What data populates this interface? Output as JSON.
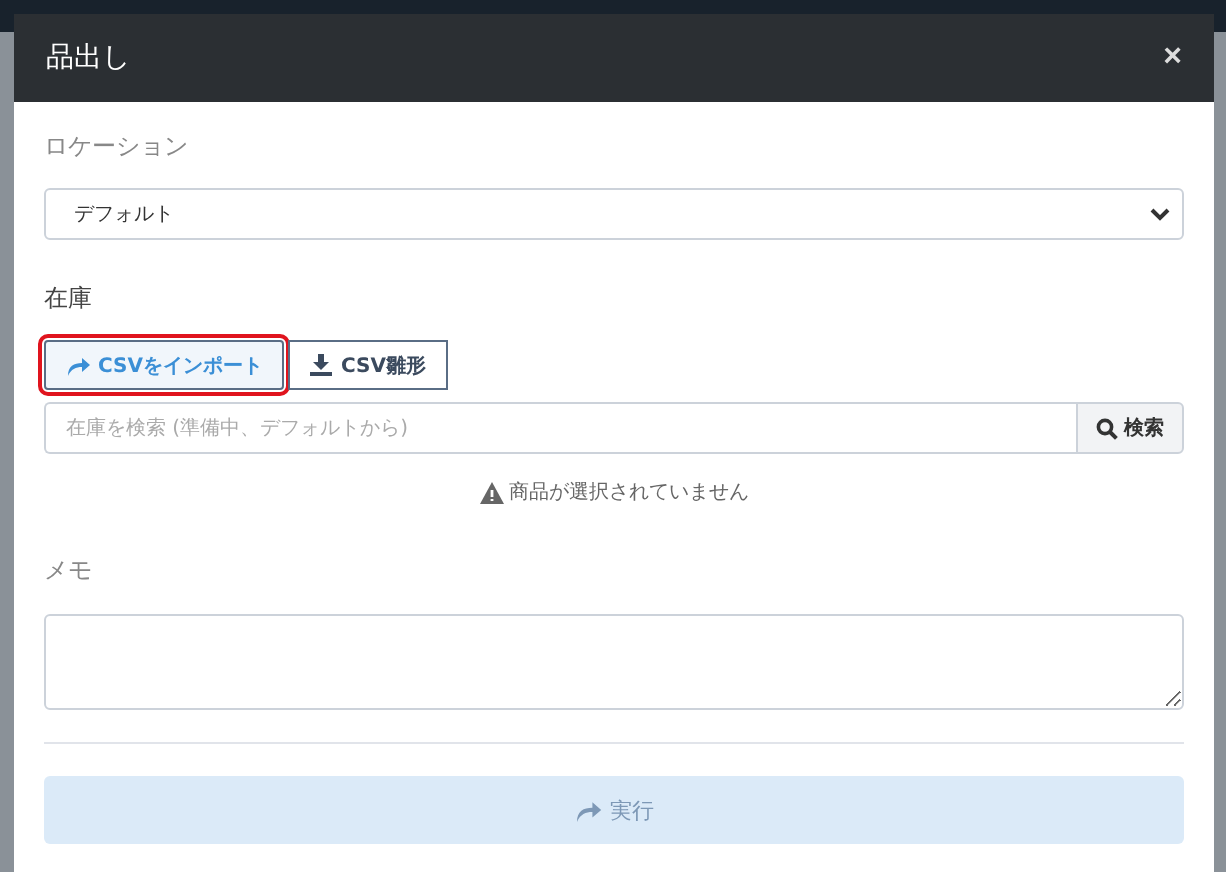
{
  "dialog": {
    "title": "品出し",
    "close": "×"
  },
  "location": {
    "label": "ロケーション",
    "value": "デフォルト"
  },
  "stock": {
    "label": "在庫",
    "buttons": [
      {
        "label": "CSVをインポート",
        "highlighted": true
      },
      {
        "label": "CSV雛形",
        "highlighted": false
      }
    ],
    "search": {
      "placeholder": "在庫を検索 (準備中、デフォルトから)",
      "button": "検索"
    },
    "empty_message": "商品が選択されていません"
  },
  "memo": {
    "label": "メモ"
  },
  "submit": {
    "label": "実行",
    "disabled": true
  }
}
